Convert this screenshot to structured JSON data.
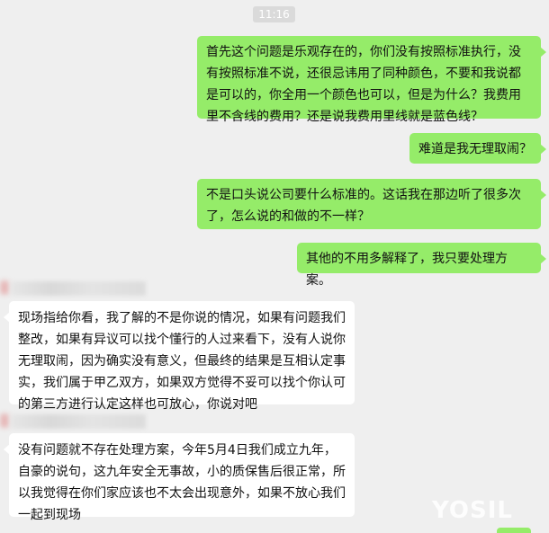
{
  "timestamp": "11:16",
  "messages": [
    {
      "from": "me",
      "text": "首先这个问题是乐观存在的，你们没有按照标准执行，没有按照标准不说，还很忌讳用了同种颜色，不要和我说都是可以的，你全用一个颜色也可以，但是为什么？我费用里不含线的费用？还是说我费用里线就是蓝色线？"
    },
    {
      "from": "me",
      "text": "难道是我无理取闹？"
    },
    {
      "from": "me",
      "text": "不是口头说公司要什么标准的。这话我在那边听了很多次了，怎么说的和做的不一样？"
    },
    {
      "from": "me",
      "text": "其他的不用多解释了，我只要处理方案。"
    },
    {
      "from": "them",
      "text": "现场指给你看，我了解的不是你说的情况，如果有问题我们整改，如果有异议可以找个懂行的人过来看下，没有人说你无理取闹，因为确实没有意义，但最终的结果是互相认定事实，我们属于甲乙双方，如果双方觉得不妥可以找个你认可的第三方进行认定这样也可放心，你说对吧"
    },
    {
      "from": "them",
      "text": "没有问题就不存在处理方案，今年5月4日我们成立九年，自豪的说句，这九年安全无事故，小的质保售后很正常，所以我觉得在你们家应该也不太会出现意外，如果不放心我们一起到现场"
    }
  ],
  "watermark": "YOSIL",
  "colors": {
    "my_bubble": "#95ec69",
    "their_bubble": "#ffffff",
    "background": "#efefef",
    "timestamp_bg": "#dadada"
  }
}
